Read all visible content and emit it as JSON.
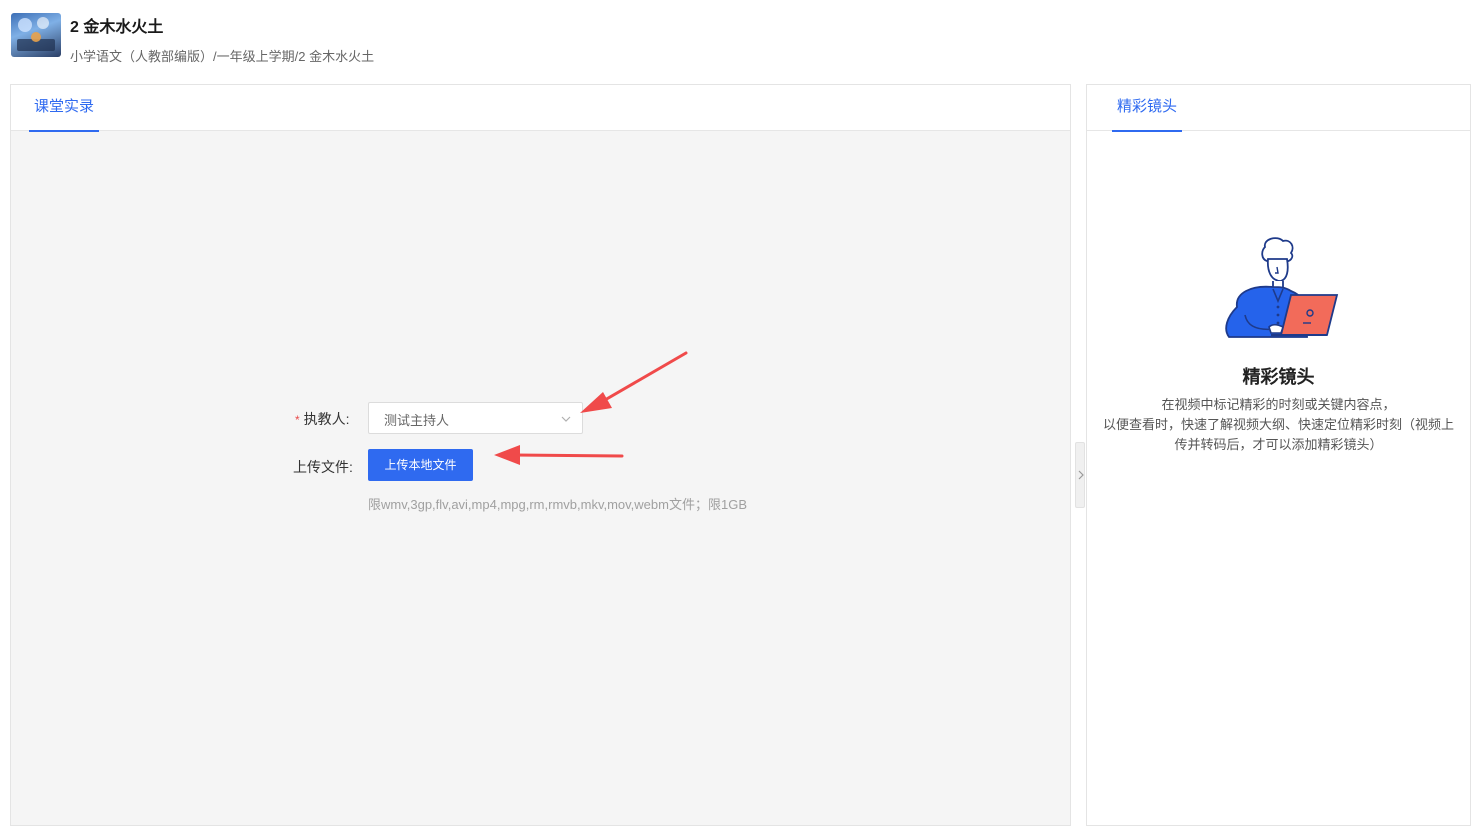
{
  "header": {
    "title": "2 金木水火土",
    "breadcrumb": "小学语文（人教部编版）/一年级上学期/2 金木水火土"
  },
  "left_panel": {
    "tab": "课堂实录",
    "form": {
      "teacher_label": "执教人:",
      "teacher_required_mark": "*",
      "teacher_value": "测试主持人",
      "upload_label": "上传文件:",
      "upload_button": "上传本地文件",
      "upload_hint": "限wmv,3gp,flv,avi,mp4,mpg,rm,rmvb,mkv,mov,webm文件；限1GB"
    }
  },
  "right_panel": {
    "tab": "精彩镜头",
    "empty_title": "精彩镜头",
    "empty_desc_line1": "在视频中标记精彩的时刻或关键内容点，",
    "empty_desc_line2": "以便查看时，快速了解视频大纲、快速定位精彩时刻（视频上传并转码后，才可以添加精彩镜头）"
  },
  "colors": {
    "accent": "#2f6af0",
    "annotation_arrow": "#f04a4a",
    "required": "#e84b4b"
  },
  "icons": [
    "chevron-down-icon",
    "chevron-right-icon",
    "person-laptop-illustration"
  ]
}
